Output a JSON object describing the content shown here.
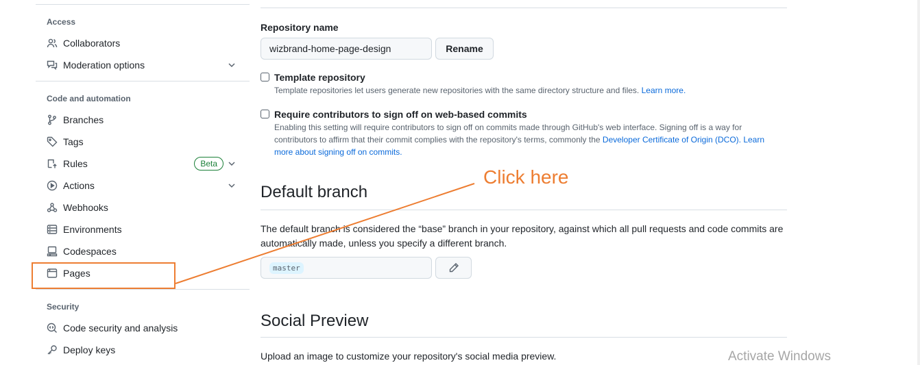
{
  "sidebar": {
    "sections": {
      "access": "Access",
      "code_automation": "Code and automation",
      "security": "Security"
    },
    "items": {
      "collaborators": "Collaborators",
      "moderation": "Moderation options",
      "branches": "Branches",
      "tags": "Tags",
      "rules": "Rules",
      "rules_badge": "Beta",
      "actions": "Actions",
      "webhooks": "Webhooks",
      "environments": "Environments",
      "codespaces": "Codespaces",
      "pages": "Pages",
      "code_security": "Code security and analysis",
      "deploy_keys": "Deploy keys"
    }
  },
  "main": {
    "repo_name_label": "Repository name",
    "repo_name_value": "wizbrand-home-page-design",
    "rename_button": "Rename",
    "template": {
      "label": "Template repository",
      "note": "Template repositories let users generate new repositories with the same directory structure and files.",
      "link": "Learn more."
    },
    "signoff": {
      "label": "Require contributors to sign off on web-based commits",
      "note_line1": "Enabling this setting will require contributors to sign off on commits made through GitHub's web interface. Signing off is a way for",
      "note_line2_pre": "contributors to affirm that their commit complies with the repository's terms, commonly the",
      "note_line2_link": "Developer Certificate of Origin (DCO). Learn",
      "note_line3_link": "more about signing off on commits."
    },
    "default_branch": {
      "title": "Default branch",
      "line1": "The default branch is considered the “base” branch in your repository, against which all pull requests and code commits are",
      "line2": "automatically made, unless you specify a different branch.",
      "branch": "master"
    },
    "social_preview": {
      "title": "Social Preview",
      "text": "Upload an image to customize your repository's social media preview."
    }
  },
  "annotation": {
    "text": "Click here",
    "color": "#ed7d31"
  },
  "watermark": "Activate Windows"
}
